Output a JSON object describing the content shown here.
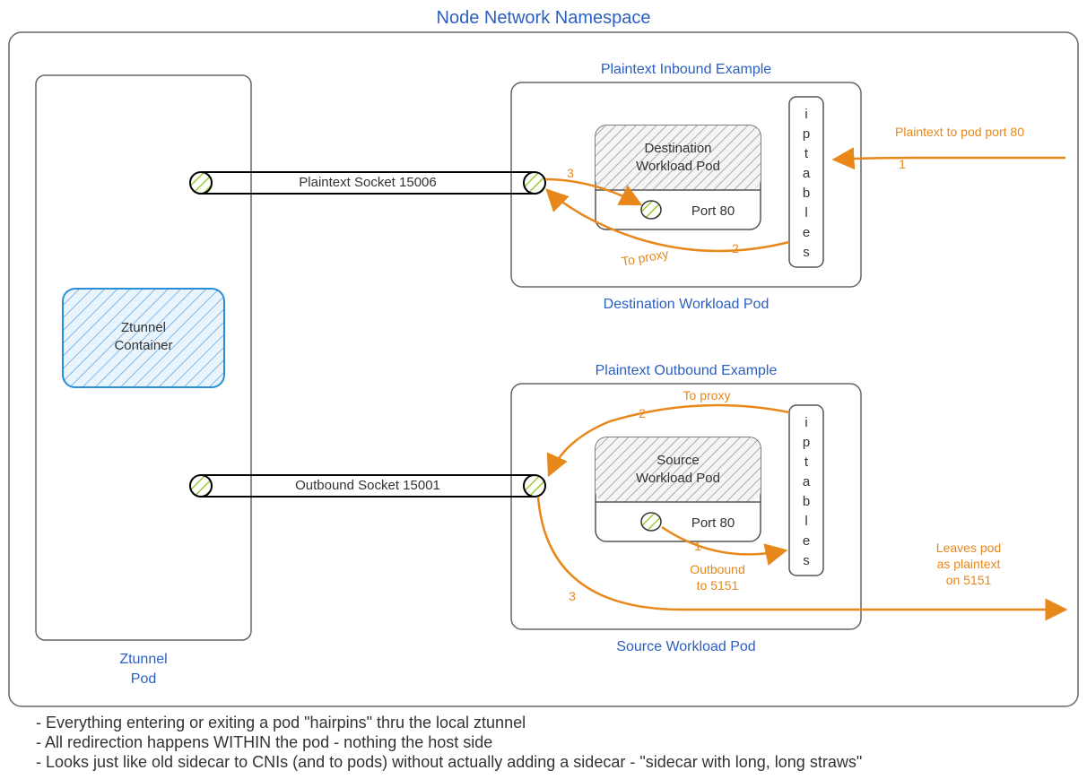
{
  "title": "Node Network Namespace",
  "ztunnel": {
    "pod_label": "Ztunnel",
    "pod_label2": "Pod",
    "container": "Ztunnel Container"
  },
  "sockets": {
    "inbound": "Plaintext Socket 15006",
    "outbound": "Outbound Socket 15001"
  },
  "destination": {
    "example_label": "Plaintext Inbound Example",
    "pod_caption": "Destination Workload Pod",
    "workload_name1": "Destination",
    "workload_name2": "Workload Pod",
    "port_label": "Port 80",
    "iptables": "iptables",
    "arrows": {
      "in_external": "Plaintext to pod port 80",
      "to_proxy": "To proxy",
      "step1": "1",
      "step2": "2",
      "step3": "3"
    }
  },
  "source": {
    "example_label": "Plaintext Outbound Example",
    "pod_caption": "Source Workload Pod",
    "workload_name1": "Source",
    "workload_name2": "Workload Pod",
    "port_label": "Port 80",
    "iptables": "iptables",
    "arrows": {
      "to_proxy": "To proxy",
      "outbound1": "Outbound",
      "outbound2": "to 5151",
      "leaves1": "Leaves pod",
      "leaves2": "as plaintext",
      "leaves3": "on 5151",
      "step1": "1",
      "step2": "2",
      "step3": "3"
    }
  },
  "footer": {
    "l1": "- Everything entering or exiting a pod \"hairpins\" thru the local ztunnel",
    "l2": "- All redirection happens WITHIN the pod - nothing the host side",
    "l3": "- Looks just like old sidecar to CNIs (and to pods) without actually adding a sidecar - \"sidecar with long, long straws\""
  }
}
